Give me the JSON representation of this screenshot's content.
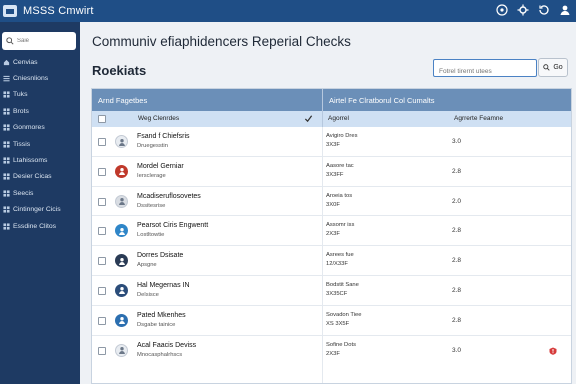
{
  "app": {
    "title": "MSSS Cmwirt"
  },
  "topbar": {
    "icons": [
      "help-icon",
      "settings-icon",
      "refresh-icon",
      "user-icon"
    ]
  },
  "sidebar": {
    "search_placeholder": "Saie",
    "items": [
      {
        "label": "Cenvias",
        "icon": "home-icon"
      },
      {
        "label": "Cniesnlions",
        "icon": "list-icon"
      },
      {
        "label": "Tuks",
        "icon": "grid-icon"
      },
      {
        "label": "Brots",
        "icon": "grid-icon"
      },
      {
        "label": "Gonmores",
        "icon": "grid-icon"
      },
      {
        "label": "Tissis",
        "icon": "grid-icon"
      },
      {
        "label": "Ltahissoms",
        "icon": "grid-icon"
      },
      {
        "label": "Desier Cicas",
        "icon": "grid-icon"
      },
      {
        "label": "Seecis",
        "icon": "grid-icon"
      },
      {
        "label": "Cintinnger Cicis",
        "icon": "grid-icon"
      },
      {
        "label": "Essdine Clitos",
        "icon": "grid-icon"
      }
    ]
  },
  "main": {
    "page_title": "Communiv efiaphidencers Reperial Checks",
    "section_title": "Roekiats",
    "search_placeholder": "Fotrel tirernt utees",
    "go_label": "Go"
  },
  "table": {
    "group_headers": [
      "Arnd Fagetbes",
      "Airtel Fe Clratborul Col Cumalts"
    ],
    "columns": [
      "Weg Clenrdes",
      "Agorrel",
      "Agrrerte Feamne"
    ],
    "rows": [
      {
        "name": "Fsand f Chiefsris",
        "sub": "Druegesstin",
        "d1": "Avigiro Dres",
        "d2": "3X3F",
        "score": "3.0",
        "avatar_color": "#e8ecf1",
        "avatar_icon": "person-icon",
        "flag": false
      },
      {
        "name": "Mordel Gerniar",
        "sub": "Iersclerage",
        "d1": "Aasore tac",
        "d2": "3X3FF",
        "score": "2.8",
        "avatar_color": "#c0392b",
        "avatar_icon": "person-icon",
        "flag": false
      },
      {
        "name": "Mcadiseruflosovetes",
        "sub": "Dssitesrise",
        "d1": "Aroeia tos",
        "d2": "3X0F",
        "score": "2.0",
        "avatar_color": "#d9dde3",
        "avatar_icon": "person-icon",
        "flag": false
      },
      {
        "name": "Pearsot Ciris Engwentt",
        "sub": "Lostltowtie",
        "d1": "Assomr iss",
        "d2": "2X3F",
        "score": "2.8",
        "avatar_color": "#2f86c8",
        "avatar_icon": "person-icon",
        "flag": false
      },
      {
        "name": "Dorres Dsisate",
        "sub": "Apsgne",
        "d1": "Asrees fue",
        "d2": "12/X33F",
        "score": "2.8",
        "avatar_color": "#2a3b55",
        "avatar_icon": "person-icon",
        "flag": false
      },
      {
        "name": "Hal Megernas IN",
        "sub": "Delsisce",
        "d1": "Bodstit Sane",
        "d2": "3X35CF",
        "score": "2.8",
        "avatar_color": "#2b4d7a",
        "avatar_icon": "person-icon",
        "flag": false
      },
      {
        "name": "Pated Mkenhes",
        "sub": "Dsgabe tainice",
        "d1": "Sovadon Tiee",
        "d2": "XS 3X5F",
        "score": "2.8",
        "avatar_color": "#2c6fb0",
        "avatar_icon": "person-icon",
        "flag": false
      },
      {
        "name": "Acal Faacis Deviss",
        "sub": "Mnocasphalrhscs",
        "d1": "Sofine Dots",
        "d2": "2X3F",
        "score": "3.0",
        "avatar_color": "#e8ecf1",
        "avatar_icon": "person-icon",
        "flag": true
      }
    ]
  },
  "colors": {
    "topbar": "#1f4e86",
    "sidebar": "#1e3a63",
    "group_header": "#6b8fb8",
    "column_header": "#cfe0f3",
    "flag": "#d63a3a"
  }
}
